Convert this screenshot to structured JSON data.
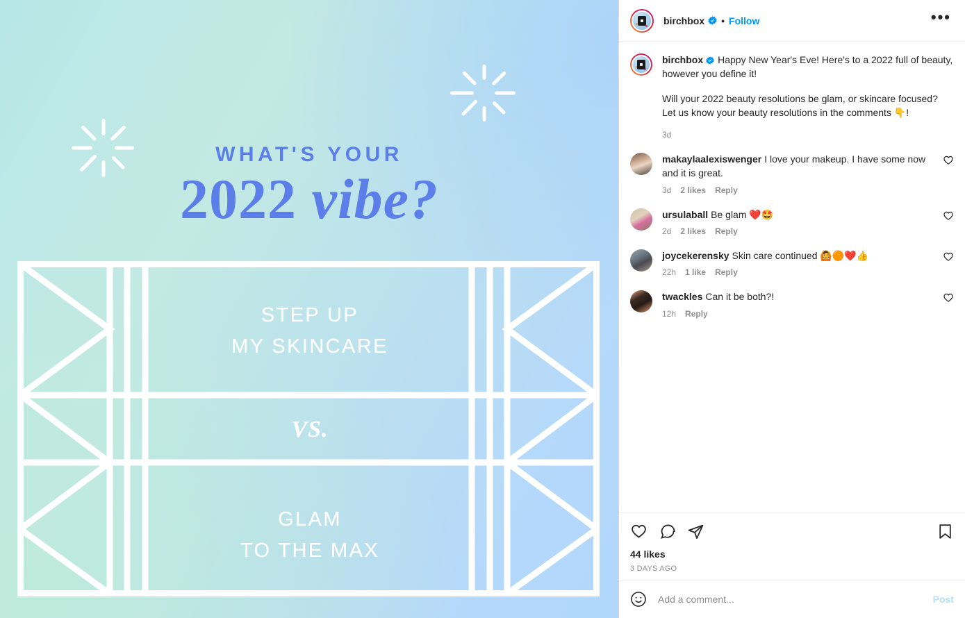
{
  "post": {
    "header": {
      "username": "birchbox",
      "verified_icon": "verified-badge-icon",
      "separator": "•",
      "follow_label": "Follow",
      "more_options_label": "•••"
    },
    "caption": {
      "username": "birchbox",
      "paragraphs": [
        "Happy New Year's Eve! Here's to a 2022 full of beauty, however you define it!",
        "Will your 2022 beauty resolutions be glam, or skincare focused? Let us know your beauty resolutions in the comments 👇!"
      ],
      "time": "3d"
    },
    "comments": [
      {
        "username": "makaylaalexiswenger",
        "text": "I love your makeup. I have some now and it is great.",
        "time": "3d",
        "likes": "2 likes",
        "reply": "Reply",
        "like_icon": "heart-outline-icon"
      },
      {
        "username": "ursulaball",
        "text": "Be glam ❤️🤩",
        "time": "2d",
        "likes": "2 likes",
        "reply": "Reply",
        "like_icon": "heart-outline-icon"
      },
      {
        "username": "joycekerensky",
        "text": "Skin care continued 🙆🟠❤️👍",
        "time": "22h",
        "likes": "1 like",
        "reply": "Reply",
        "like_icon": "heart-outline-icon"
      },
      {
        "username": "twackles",
        "text": "Can it be both?!",
        "time": "12h",
        "likes": "",
        "reply": "Reply",
        "like_icon": "heart-outline-icon"
      }
    ],
    "actions": {
      "like_icon": "heart-outline-icon",
      "comment_icon": "speech-bubble-icon",
      "share_icon": "paper-plane-icon",
      "save_icon": "bookmark-outline-icon",
      "likes_count": "44 likes",
      "timestamp": "3 DAYS AGO"
    },
    "add_comment": {
      "emoji_icon": "smiley-face-icon",
      "placeholder": "Add a comment...",
      "value": "",
      "post_label": "Post"
    }
  },
  "media": {
    "headline_top": "WHAT'S YOUR",
    "headline_main_plain": "2022 ",
    "headline_main_italic": "vibe?",
    "panel": {
      "top_label_line1": "STEP UP",
      "top_label_line2": "MY SKINCARE",
      "middle_label": "VS.",
      "bottom_label_line1": "GLAM",
      "bottom_label_line2": "TO THE MAX"
    },
    "decorations": [
      {
        "name": "sparkle-burst-top-right"
      },
      {
        "name": "sparkle-burst-left"
      }
    ],
    "colors": {
      "headline": "#5b7ee8",
      "panel_line": "#ffffff",
      "bg_mint": "#bfe9e4",
      "bg_blue": "#b3d8fc",
      "accent_link": "#0095f6",
      "verified_blue": "#0095f6"
    }
  }
}
